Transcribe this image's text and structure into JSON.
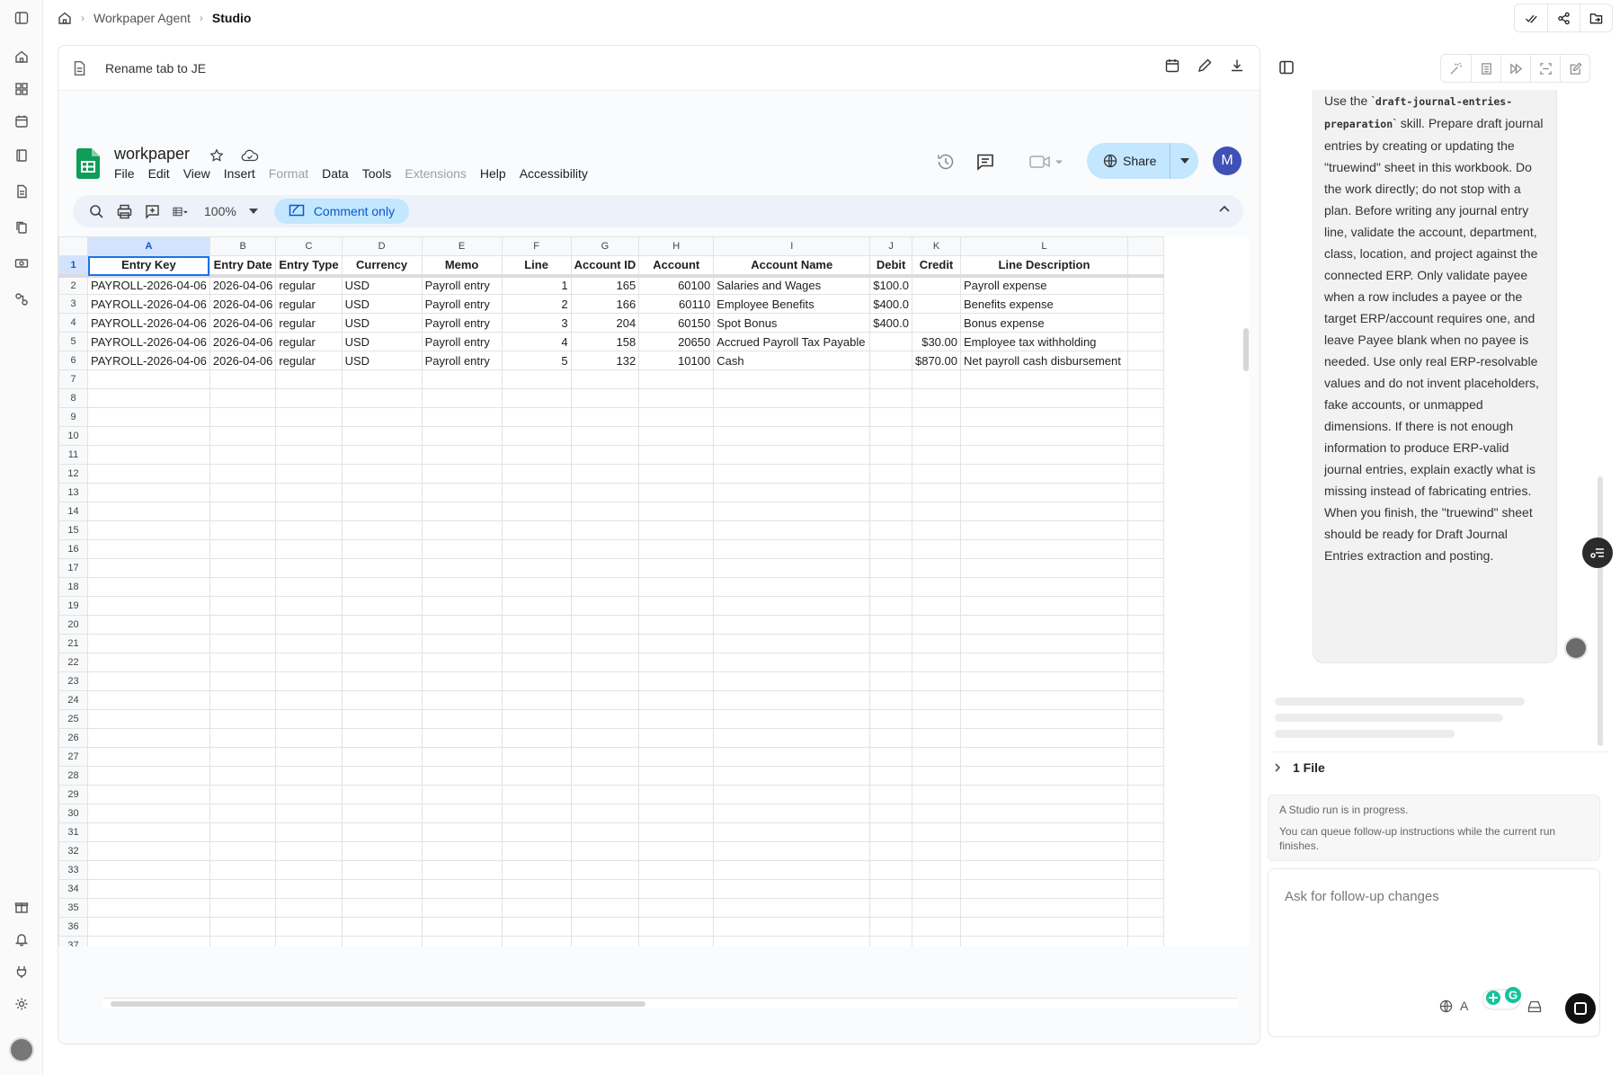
{
  "breadcrumb": [
    "Workpaper Agent",
    "Studio"
  ],
  "document": {
    "title": "Rename tab to JE"
  },
  "sheets": {
    "file_name": "workpaper",
    "menu": [
      {
        "label": "File",
        "disabled": false
      },
      {
        "label": "Edit",
        "disabled": false
      },
      {
        "label": "View",
        "disabled": false
      },
      {
        "label": "Insert",
        "disabled": false
      },
      {
        "label": "Format",
        "disabled": true
      },
      {
        "label": "Data",
        "disabled": false
      },
      {
        "label": "Tools",
        "disabled": false
      },
      {
        "label": "Extensions",
        "disabled": true
      },
      {
        "label": "Help",
        "disabled": false
      },
      {
        "label": "Accessibility",
        "disabled": false
      }
    ],
    "share_label": "Share",
    "user_initial": "M",
    "zoom": "100%",
    "mode_label": "Comment only",
    "columns": [
      "A",
      "B",
      "C",
      "D",
      "E",
      "F",
      "G",
      "H",
      "I",
      "J",
      "K",
      "L"
    ],
    "header_row": [
      "Entry Key",
      "Entry Date",
      "Entry Type",
      "Currency",
      "Memo",
      "Line",
      "Account ID",
      "Account",
      "Account Name",
      "Debit",
      "Credit",
      "Line Description"
    ],
    "rows": [
      [
        "PAYROLL-2026-04-06",
        "2026-04-06",
        "regular",
        "USD",
        "Payroll entry",
        "1",
        "165",
        "60100",
        "Salaries and Wages",
        "$100.0",
        "",
        "Payroll expense"
      ],
      [
        "PAYROLL-2026-04-06",
        "2026-04-06",
        "regular",
        "USD",
        "Payroll entry",
        "2",
        "166",
        "60110",
        "Employee Benefits",
        "$400.0",
        "",
        "Benefits expense"
      ],
      [
        "PAYROLL-2026-04-06",
        "2026-04-06",
        "regular",
        "USD",
        "Payroll entry",
        "3",
        "204",
        "60150",
        "Spot Bonus",
        "$400.0",
        "",
        "Bonus expense"
      ],
      [
        "PAYROLL-2026-04-06",
        "2026-04-06",
        "regular",
        "USD",
        "Payroll entry",
        "4",
        "158",
        "20650",
        "Accrued Payroll Tax Payable",
        "",
        "$30.00",
        "Employee tax withholding"
      ],
      [
        "PAYROLL-2026-04-06",
        "2026-04-06",
        "regular",
        "USD",
        "Payroll entry",
        "5",
        "132",
        "10100",
        "Cash",
        "",
        "$870.00",
        "Net payroll cash disbursement"
      ]
    ],
    "row_count": 41,
    "tab_name": "JE"
  },
  "chat": {
    "message_prefix": "Use the `",
    "skill_code": "draft-journal-entries-preparation",
    "message_body": "` skill. Prepare draft journal entries by creating or updating the \"truewind\" sheet in this workbook. Do the work directly; do not stop with a plan. Before writing any journal entry line, validate the account, department, class, location, and project against the connected ERP. Only validate payee when a row includes a payee or the target ERP/account requires one, and leave Payee blank when no payee is needed. Use only real ERP-resolvable values and do not invent placeholders, fake accounts, or unmapped dimensions. If there is not enough information to produce ERP-valid journal entries, explain exactly what is missing instead of fabricating entries. When you finish, the \"truewind\" sheet should be ready for Draft Journal Entries extraction and posting.",
    "files_label": "1 File",
    "run_status_1": "A Studio run is in progress.",
    "run_status_2": "You can queue follow-up instructions while the current run finishes.",
    "input_placeholder": "Ask for follow-up changes",
    "lang_label": "A"
  },
  "colors": {
    "accent_blue": "#0b57d0",
    "selection_blue": "#1a73e8",
    "share_bg": "#c2e7ff",
    "sheets_green": "#0f9d58"
  }
}
